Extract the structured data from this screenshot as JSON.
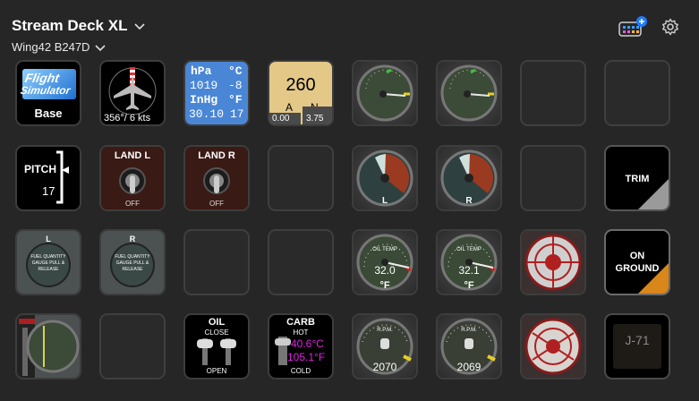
{
  "header": {
    "title": "Stream Deck XL",
    "profile": "Wing42 B247D"
  },
  "keys": {
    "fs_base": {
      "line1": "Flight",
      "line2": "Simulator",
      "label": "Base"
    },
    "wind": {
      "readout": "356°/ 6 kts"
    },
    "baro": {
      "hpa": "hPa",
      "c": "°C",
      "hpa_val": "1019",
      "c_val": "-8",
      "inhg": "InHg",
      "f": "°F",
      "inhg_val": "30.10",
      "f_val": "17"
    },
    "freq": {
      "value": "260",
      "a": "A",
      "n": "N",
      "a_val": "0.00",
      "n_val": "3.75"
    },
    "pitch": {
      "label": "PITCH",
      "value": "17"
    },
    "land_l": {
      "label": "LAND L",
      "state": "OFF"
    },
    "land_r": {
      "label": "LAND R",
      "state": "OFF"
    },
    "oil_l": {
      "label": "L"
    },
    "oil_r": {
      "label": "R"
    },
    "trim": {
      "label": "TRIM"
    },
    "fuel_l": {
      "label": "L",
      "caption": "FUEL QUANTITY GAUGE PULL & RELEASE"
    },
    "fuel_r": {
      "label": "R",
      "caption": "FUEL QUANTITY GAUGE PULL & RELEASE"
    },
    "oiltemp_l": {
      "name": "OIL TEMP",
      "value": "32.0",
      "unit": "°F"
    },
    "oiltemp_r": {
      "name": "OIL TEMP",
      "value": "32.1",
      "unit": "°F"
    },
    "on_ground": {
      "line1": "ON",
      "line2": "GROUND"
    },
    "oil_shutter": {
      "label": "OIL",
      "close": "CLOSE",
      "open": "OPEN"
    },
    "carb": {
      "label": "CARB",
      "hot": "HOT",
      "cold": "COLD",
      "c_val": "40.6",
      "c_unit": "°C",
      "f_val": "105.1",
      "f_unit": "°F"
    },
    "rpm_l": {
      "label": "R.P.M.",
      "value": "2070"
    },
    "rpm_r": {
      "label": "R.P.M.",
      "value": "2069"
    },
    "ident": {
      "label": "J-71"
    }
  }
}
